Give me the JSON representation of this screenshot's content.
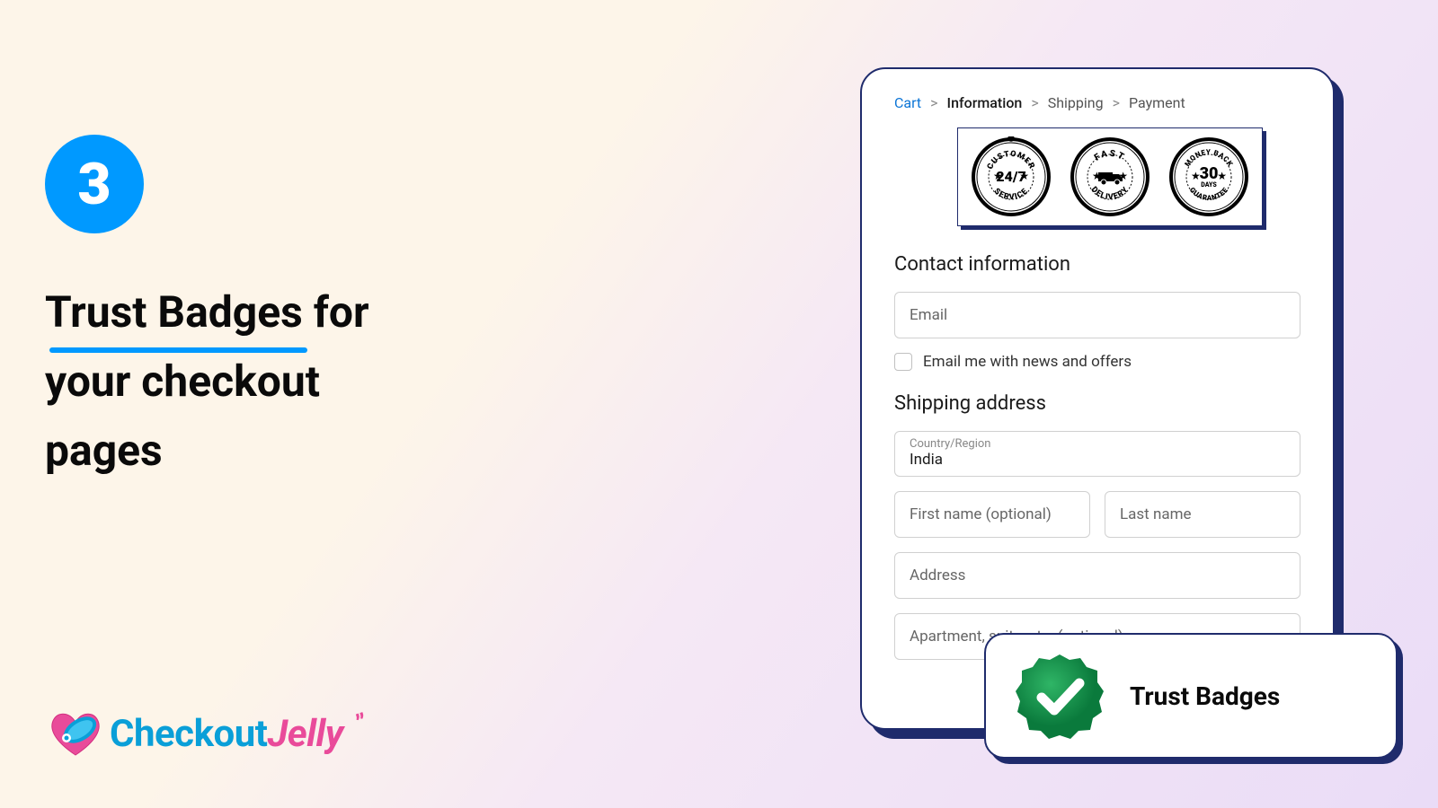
{
  "step_number": "3",
  "headline": {
    "line1_underlined": "Trust Badges",
    "line1_rest": " for",
    "line2": "your checkout",
    "line3": "pages"
  },
  "logo": {
    "part1": "Checkout",
    "part2": "Jelly"
  },
  "breadcrumb": {
    "cart": "Cart",
    "information": "Information",
    "shipping": "Shipping",
    "payment": "Payment",
    "sep": ">"
  },
  "badges": [
    {
      "top": "CUSTOMER",
      "center": "24/7",
      "bottom": "SERVICE"
    },
    {
      "top": "FAST",
      "center_icon": "truck",
      "bottom": "DELIVERY"
    },
    {
      "top": "MONEY BACK",
      "center": "30",
      "center_sub": "DAYS",
      "bottom": "GUARANTEE"
    }
  ],
  "form": {
    "contact_title": "Contact information",
    "email_placeholder": "Email",
    "newsletter_label": "Email me with news and offers",
    "shipping_title": "Shipping address",
    "country_label": "Country/Region",
    "country_value": "India",
    "first_name_placeholder": "First name (optional)",
    "last_name_placeholder": "Last name",
    "address_placeholder": "Address",
    "apt_placeholder": "Apartment, suite, etc. (optional)"
  },
  "callout_label": "Trust Badges"
}
